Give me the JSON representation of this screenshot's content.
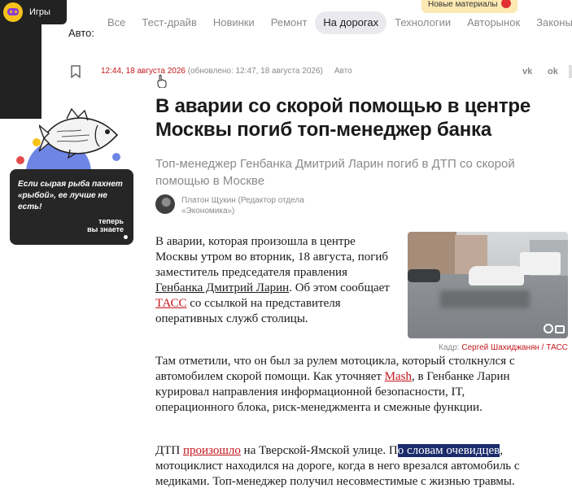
{
  "games": {
    "label": "Игры"
  },
  "promo": {
    "text": "Если сырая рыба пахнет «рыбой», ее лучше не есть!",
    "footer_line1": "теперь",
    "footer_line2": "вы знаете"
  },
  "nav": {
    "label": "Авто:",
    "tabs": [
      "Все",
      "Тест-драйв",
      "Новинки",
      "Ремонт",
      "На дорогах",
      "Технологии",
      "Авторынок",
      "Законы"
    ],
    "active": "На дорогах",
    "new_materials": "Новые материалы"
  },
  "meta": {
    "time": "12:44, 18 августа 2026",
    "updated": " (обновлено: 12:47, 18 августа 2026)",
    "category": "Авто",
    "vk": "vk",
    "ok": "ok"
  },
  "article": {
    "title": "В аварии со скорой помощью в центре Москвы погиб топ-менеджер банка",
    "lead": "Топ-менеджер Генбанка Дмитрий Ларин погиб в ДТП со скорой помощью в Москве",
    "author": "Платон Щукин (Редактор отдела «Экономика»)",
    "photo_caption_prefix": "Кадр: ",
    "photo_caption_author": "Сергей Шахиджанян / ТАСС",
    "p1": {
      "a": "В аварии, которая произошла в центре Москвы утром во вторник, 18 августа, погиб заместитель председателя правления ",
      "link1": "Генбанка Дмитрий Ларин",
      "b": ". Об этом сообщает ",
      "link2": "ТАСС",
      "c": " со ссылкой на представителя оперативных служб столицы."
    },
    "p2": {
      "a": "Там отметили, что он был за рулем мотоцикла, который столкнулся с автомобилем скорой помощи. Как уточняет ",
      "link": "Mash",
      "b": ", в Генбанке Ларин курировал направления информационной безопасности, IT, операционного блока, риск-менеджмента и смежные функции."
    },
    "p3": {
      "a": "ДТП ",
      "link": "произошло",
      "b": " на Тверской-Ямской улице. П",
      "highlight": "о словам очевидцев",
      "c": ", мотоциклист находился на дороге, когда в него врезался автомобиль с медиками. Топ-менеджер получил несовместимые с жизнью травмы."
    }
  }
}
